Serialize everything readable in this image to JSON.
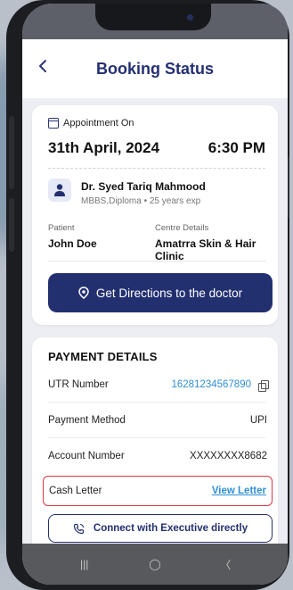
{
  "header": {
    "title": "Booking Status"
  },
  "appointment": {
    "label": "Appointment On",
    "date": "31th April, 2024",
    "time": "6:30 PM"
  },
  "doctor": {
    "name": "Dr. Syed Tariq Mahmood",
    "qualification": "MBBS,Diploma",
    "experience": "25 years exp"
  },
  "patient": {
    "label": "Patient",
    "value": "John Doe"
  },
  "centre": {
    "label": "Centre Details",
    "value": "Amatrra Skin & Hair Clinic"
  },
  "directions_button": "Get Directions to the doctor",
  "payment": {
    "title": "PAYMENT DETAILS",
    "utr_label": "UTR Number",
    "utr_value": "16281234567890",
    "method_label": "Payment Method",
    "method_value": "UPI",
    "account_label": "Account Number",
    "account_value": "XXXXXXXX8682",
    "cash_label": "Cash Letter",
    "cash_link": "View Letter"
  },
  "connect_button": "Connect with Executive directly",
  "navbar": {
    "recents_glyph": "|||",
    "home_glyph": "◯",
    "back_glyph": "〈"
  },
  "colors": {
    "primary": "#233070",
    "link": "#2f8fd6",
    "highlight": "#d9393f",
    "background": "#eceef3"
  },
  "icons": [
    "back-chevron-icon",
    "calendar-icon",
    "doctor-avatar-icon",
    "location-pin-icon",
    "copy-icon",
    "phone-call-icon"
  ]
}
